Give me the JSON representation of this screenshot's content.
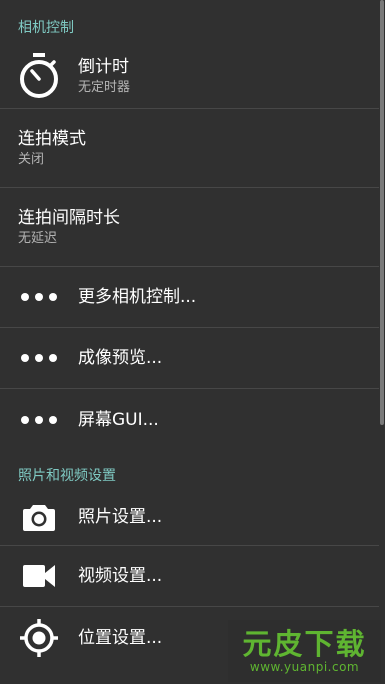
{
  "sections": [
    {
      "header": "相机控制"
    },
    {
      "header": "照片和视频设置"
    }
  ],
  "items": [
    {
      "title": "倒计时",
      "subtitle": "无定时器",
      "icon": "timer-icon"
    },
    {
      "title": "连拍模式",
      "subtitle": "关闭"
    },
    {
      "title": "连拍间隔时长",
      "subtitle": "无延迟"
    },
    {
      "title": "更多相机控制...",
      "icon": "more-dots-icon"
    },
    {
      "title": "成像预览...",
      "icon": "more-dots-icon"
    },
    {
      "title": "屏幕GUI...",
      "icon": "more-dots-icon"
    },
    {
      "title": "照片设置...",
      "icon": "camera-icon"
    },
    {
      "title": "视频设置...",
      "icon": "videocam-icon"
    },
    {
      "title": "位置设置...",
      "icon": "location-target-icon"
    }
  ],
  "watermark": {
    "title": "元皮下载",
    "url": "www.yuanpi.com"
  },
  "colors": {
    "background": "#303030",
    "section_header": "#7fcac3",
    "divider": "#474747",
    "watermark": "#5fb531"
  }
}
